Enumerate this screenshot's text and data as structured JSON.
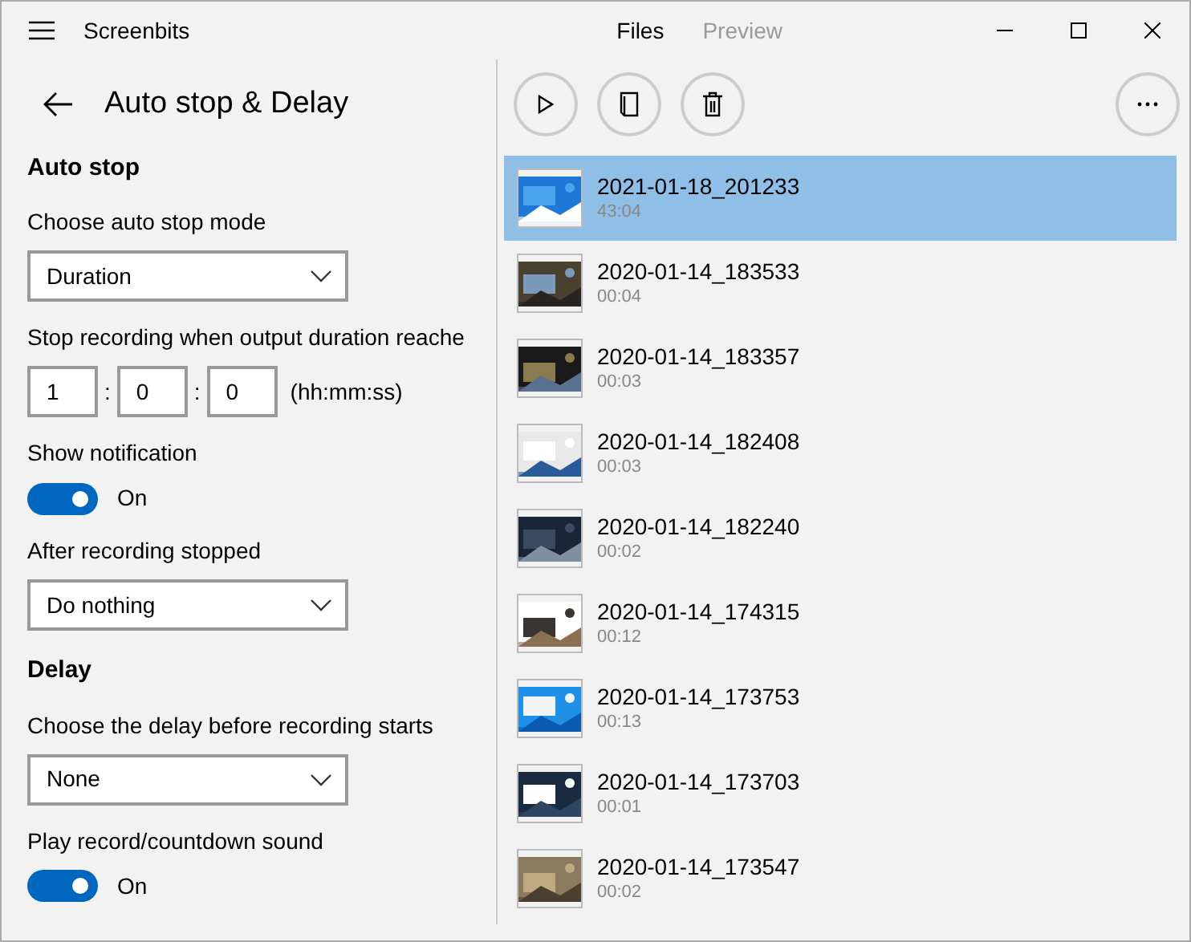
{
  "app": {
    "title": "Screenbits"
  },
  "tabs": [
    {
      "label": "Files",
      "selected": true
    },
    {
      "label": "Preview",
      "selected": false
    }
  ],
  "settings": {
    "title": "Auto stop & Delay",
    "sections": [
      {
        "kind": "heading",
        "text": "Auto stop"
      },
      {
        "kind": "dropdown",
        "label": "Choose auto stop mode",
        "value": "Duration"
      },
      {
        "kind": "time",
        "label": "Stop recording when output duration reache",
        "values": [
          "1",
          "0",
          "0"
        ],
        "separators": [
          ":",
          ":"
        ],
        "hint": "(hh:mm:ss)"
      },
      {
        "kind": "toggle",
        "label": "Show notification",
        "on": true,
        "state_text": "On"
      },
      {
        "kind": "dropdown",
        "label": "After recording stopped",
        "value": "Do nothing"
      },
      {
        "kind": "heading",
        "text": "Delay"
      },
      {
        "kind": "dropdown",
        "label": "Choose the delay before recording starts",
        "value": "None"
      },
      {
        "kind": "toggle",
        "label": "Play record/countdown sound",
        "on": true,
        "state_text": "On"
      }
    ]
  },
  "files": [
    {
      "name": "2021-01-18_201233",
      "duration": "43:04",
      "selected": true
    },
    {
      "name": "2020-01-14_183533",
      "duration": "00:04",
      "selected": false
    },
    {
      "name": "2020-01-14_183357",
      "duration": "00:03",
      "selected": false
    },
    {
      "name": "2020-01-14_182408",
      "duration": "00:03",
      "selected": false
    },
    {
      "name": "2020-01-14_182240",
      "duration": "00:02",
      "selected": false
    },
    {
      "name": "2020-01-14_174315",
      "duration": "00:12",
      "selected": false
    },
    {
      "name": "2020-01-14_173753",
      "duration": "00:13",
      "selected": false
    },
    {
      "name": "2020-01-14_173703",
      "duration": "00:01",
      "selected": false
    },
    {
      "name": "2020-01-14_173547",
      "duration": "00:02",
      "selected": false
    }
  ]
}
